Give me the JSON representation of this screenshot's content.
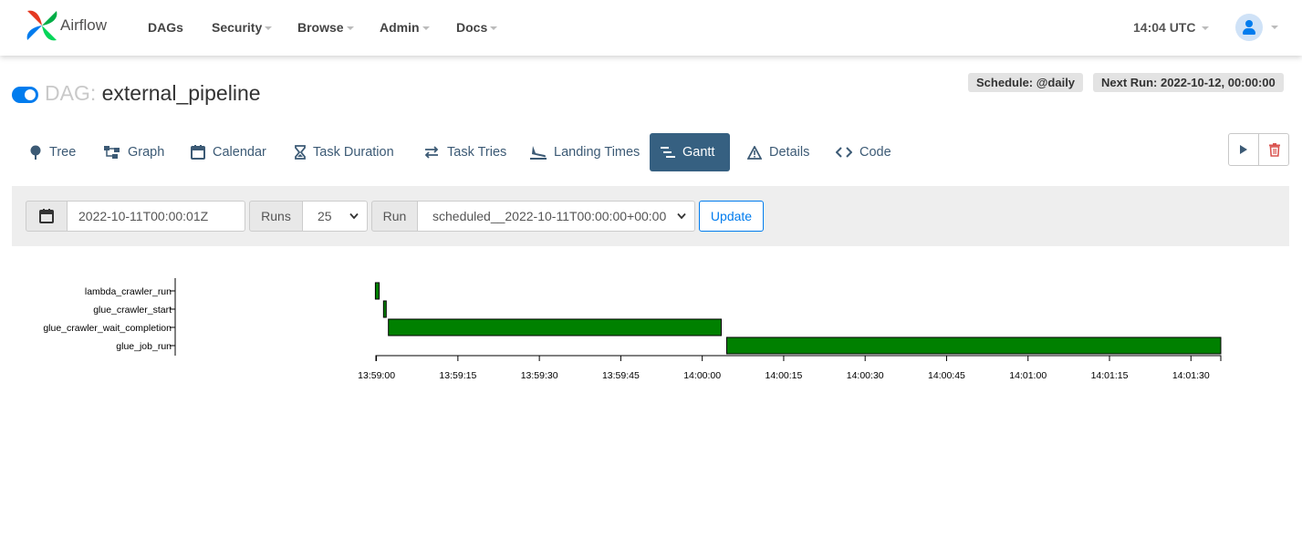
{
  "navbar": {
    "brand_name": "Airflow",
    "menu": [
      {
        "label": "DAGs",
        "dropdown": false
      },
      {
        "label": "Security",
        "dropdown": true
      },
      {
        "label": "Browse",
        "dropdown": true
      },
      {
        "label": "Admin",
        "dropdown": true
      },
      {
        "label": "Docs",
        "dropdown": true
      }
    ],
    "time": "14:04 UTC"
  },
  "dag": {
    "prefix": "DAG:",
    "id": "external_pipeline",
    "paused": false,
    "schedule_label": "Schedule: @daily",
    "next_run_label": "Next Run: 2022-10-12, 00:00:00"
  },
  "tabs": [
    {
      "label": "Tree",
      "icon": "tree-icon"
    },
    {
      "label": "Graph",
      "icon": "graph-icon"
    },
    {
      "label": "Calendar",
      "icon": "calendar-icon"
    },
    {
      "label": "Task Duration",
      "icon": "hourglass-icon"
    },
    {
      "label": "Task Tries",
      "icon": "retry-icon"
    },
    {
      "label": "Landing Times",
      "icon": "landing-icon"
    },
    {
      "label": "Gantt",
      "icon": "gantt-icon",
      "active": true
    },
    {
      "label": "Details",
      "icon": "warning-icon"
    },
    {
      "label": "Code",
      "icon": "code-icon"
    }
  ],
  "filter": {
    "base_date": "2022-10-11T00:00:01Z",
    "runs_label": "Runs",
    "runs_value": "25",
    "run_label": "Run",
    "run_value": "scheduled__2022-10-11T00:00:00+00:00",
    "update_label": "Update"
  },
  "colors": {
    "accent": "#017cee",
    "active_tab": "#366081",
    "success_bar": "#008000",
    "delete": "#d9534f"
  },
  "chart_data": {
    "type": "gantt",
    "tasks": [
      "lambda_crawler_run",
      "glue_crawler_start",
      "glue_crawler_wait_completion",
      "glue_job_run"
    ],
    "bars": [
      {
        "task": "lambda_crawler_run",
        "start": "13:58:59.8",
        "end": "13:59:00.5",
        "state": "success"
      },
      {
        "task": "glue_crawler_start",
        "start": "13:59:01.3",
        "end": "13:59:01.8",
        "state": "success"
      },
      {
        "task": "glue_crawler_wait_completion",
        "start": "13:59:02.2",
        "end": "14:00:03.5",
        "state": "success"
      },
      {
        "task": "glue_job_run",
        "start": "14:00:04.5",
        "end": "14:01:35.5",
        "state": "success"
      }
    ],
    "x_range": [
      "13:58:59.9",
      "14:01:35.5"
    ],
    "x_ticks": [
      "13:59:00",
      "13:59:15",
      "13:59:30",
      "13:59:45",
      "14:00:00",
      "14:00:15",
      "14:00:30",
      "14:00:45",
      "14:01:00",
      "14:01:15",
      "14:01:30"
    ]
  }
}
